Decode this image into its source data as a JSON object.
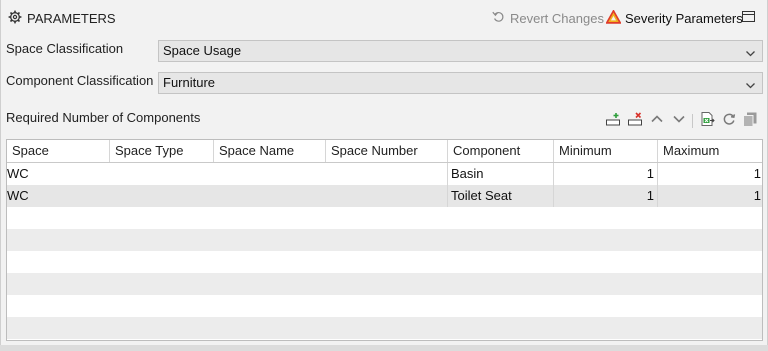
{
  "header": {
    "title": "PARAMETERS",
    "revert_label": "Revert Changes",
    "severity_label": "Severity Parameters"
  },
  "fields": {
    "space_classification_label": "Space Classification",
    "space_classification_value": "Space Usage",
    "component_classification_label": "Component Classification",
    "component_classification_value": "Furniture"
  },
  "section": {
    "required_label": "Required Number of Components"
  },
  "table": {
    "columns": [
      "Space",
      "Space Type",
      "Space Name",
      "Space Number",
      "Component",
      "Minimum",
      "Maximum"
    ],
    "rows": [
      {
        "space": "WC",
        "space_type": "",
        "space_name": "",
        "space_number": "",
        "component": "Basin",
        "minimum": "1",
        "maximum": "1"
      },
      {
        "space": "WC",
        "space_type": "",
        "space_name": "",
        "space_number": "",
        "component": "Toilet Seat",
        "minimum": "1",
        "maximum": "1"
      }
    ]
  },
  "icons": {
    "title": "gear-icon",
    "revert": "undo-icon",
    "severity": "warning-triangle-icon",
    "window": "window-icon",
    "add_row": "add-row-icon",
    "delete_row": "delete-row-icon",
    "move_up": "chevron-up-icon",
    "move_down": "chevron-down-icon",
    "export": "export-excel-icon",
    "refresh": "refresh-icon",
    "copy": "copy-icon"
  },
  "colors": {
    "warning_triangle": [
      "#e03b2a",
      "#f2b01e"
    ],
    "add_accent": "#2e9e3b",
    "delete_accent": "#d8322a"
  }
}
